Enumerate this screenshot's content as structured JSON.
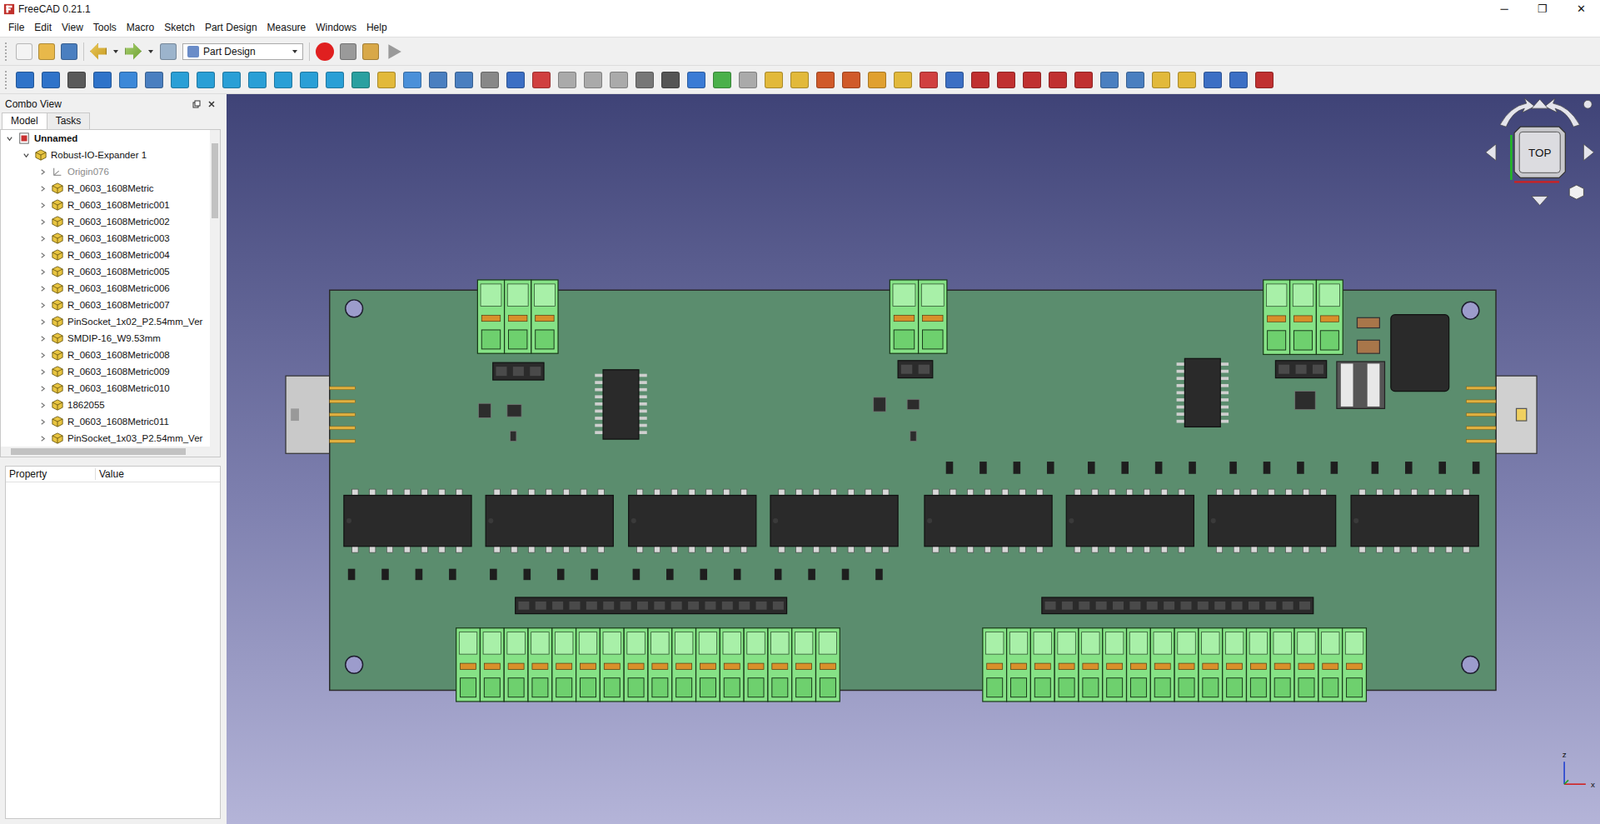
{
  "window": {
    "title": "FreeCAD 0.21.1",
    "controls": [
      "─",
      "❐",
      "✕"
    ]
  },
  "menu": [
    "File",
    "Edit",
    "View",
    "Tools",
    "Macro",
    "Sketch",
    "Part Design",
    "Measure",
    "Windows",
    "Help"
  ],
  "workbench": {
    "label": "Part Design"
  },
  "combo_view": {
    "title": "Combo View"
  },
  "tabs": [
    {
      "label": "Model",
      "selected": true
    },
    {
      "label": "Tasks",
      "selected": false
    }
  ],
  "tree": [
    {
      "label": "Unnamed",
      "depth": 0,
      "kind": "document",
      "expanded": true,
      "bold": true,
      "disabled": false
    },
    {
      "label": "Robust-IO-Expander 1",
      "depth": 1,
      "kind": "body",
      "expanded": true,
      "bold": false,
      "disabled": false
    },
    {
      "label": "Origin076",
      "depth": 2,
      "kind": "origin",
      "expanded": false,
      "bold": false,
      "disabled": true
    },
    {
      "label": "R_0603_1608Metric",
      "depth": 2,
      "kind": "part",
      "expanded": false,
      "bold": false,
      "disabled": false
    },
    {
      "label": "R_0603_1608Metric001",
      "depth": 2,
      "kind": "part",
      "expanded": false,
      "bold": false,
      "disabled": false
    },
    {
      "label": "R_0603_1608Metric002",
      "depth": 2,
      "kind": "part",
      "expanded": false,
      "bold": false,
      "disabled": false
    },
    {
      "label": "R_0603_1608Metric003",
      "depth": 2,
      "kind": "part",
      "expanded": false,
      "bold": false,
      "disabled": false
    },
    {
      "label": "R_0603_1608Metric004",
      "depth": 2,
      "kind": "part",
      "expanded": false,
      "bold": false,
      "disabled": false
    },
    {
      "label": "R_0603_1608Metric005",
      "depth": 2,
      "kind": "part",
      "expanded": false,
      "bold": false,
      "disabled": false
    },
    {
      "label": "R_0603_1608Metric006",
      "depth": 2,
      "kind": "part",
      "expanded": false,
      "bold": false,
      "disabled": false
    },
    {
      "label": "R_0603_1608Metric007",
      "depth": 2,
      "kind": "part",
      "expanded": false,
      "bold": false,
      "disabled": false
    },
    {
      "label": "PinSocket_1x02_P2.54mm_Ver",
      "depth": 2,
      "kind": "part",
      "expanded": false,
      "bold": false,
      "disabled": false
    },
    {
      "label": "SMDIP-16_W9.53mm",
      "depth": 2,
      "kind": "part",
      "expanded": false,
      "bold": false,
      "disabled": false
    },
    {
      "label": "R_0603_1608Metric008",
      "depth": 2,
      "kind": "part",
      "expanded": false,
      "bold": false,
      "disabled": false
    },
    {
      "label": "R_0603_1608Metric009",
      "depth": 2,
      "kind": "part",
      "expanded": false,
      "bold": false,
      "disabled": false
    },
    {
      "label": "R_0603_1608Metric010",
      "depth": 2,
      "kind": "part",
      "expanded": false,
      "bold": false,
      "disabled": false
    },
    {
      "label": "1862055",
      "depth": 2,
      "kind": "part",
      "expanded": false,
      "bold": false,
      "disabled": false
    },
    {
      "label": "R_0603_1608Metric011",
      "depth": 2,
      "kind": "part",
      "expanded": false,
      "bold": false,
      "disabled": false
    },
    {
      "label": "PinSocket_1x03_P2.54mm_Ver",
      "depth": 2,
      "kind": "part",
      "expanded": false,
      "bold": false,
      "disabled": false
    }
  ],
  "properties": {
    "columns": [
      "Property",
      "Value"
    ]
  },
  "nav_cube": {
    "face": "TOP"
  },
  "axes": [
    "z",
    "x"
  ]
}
